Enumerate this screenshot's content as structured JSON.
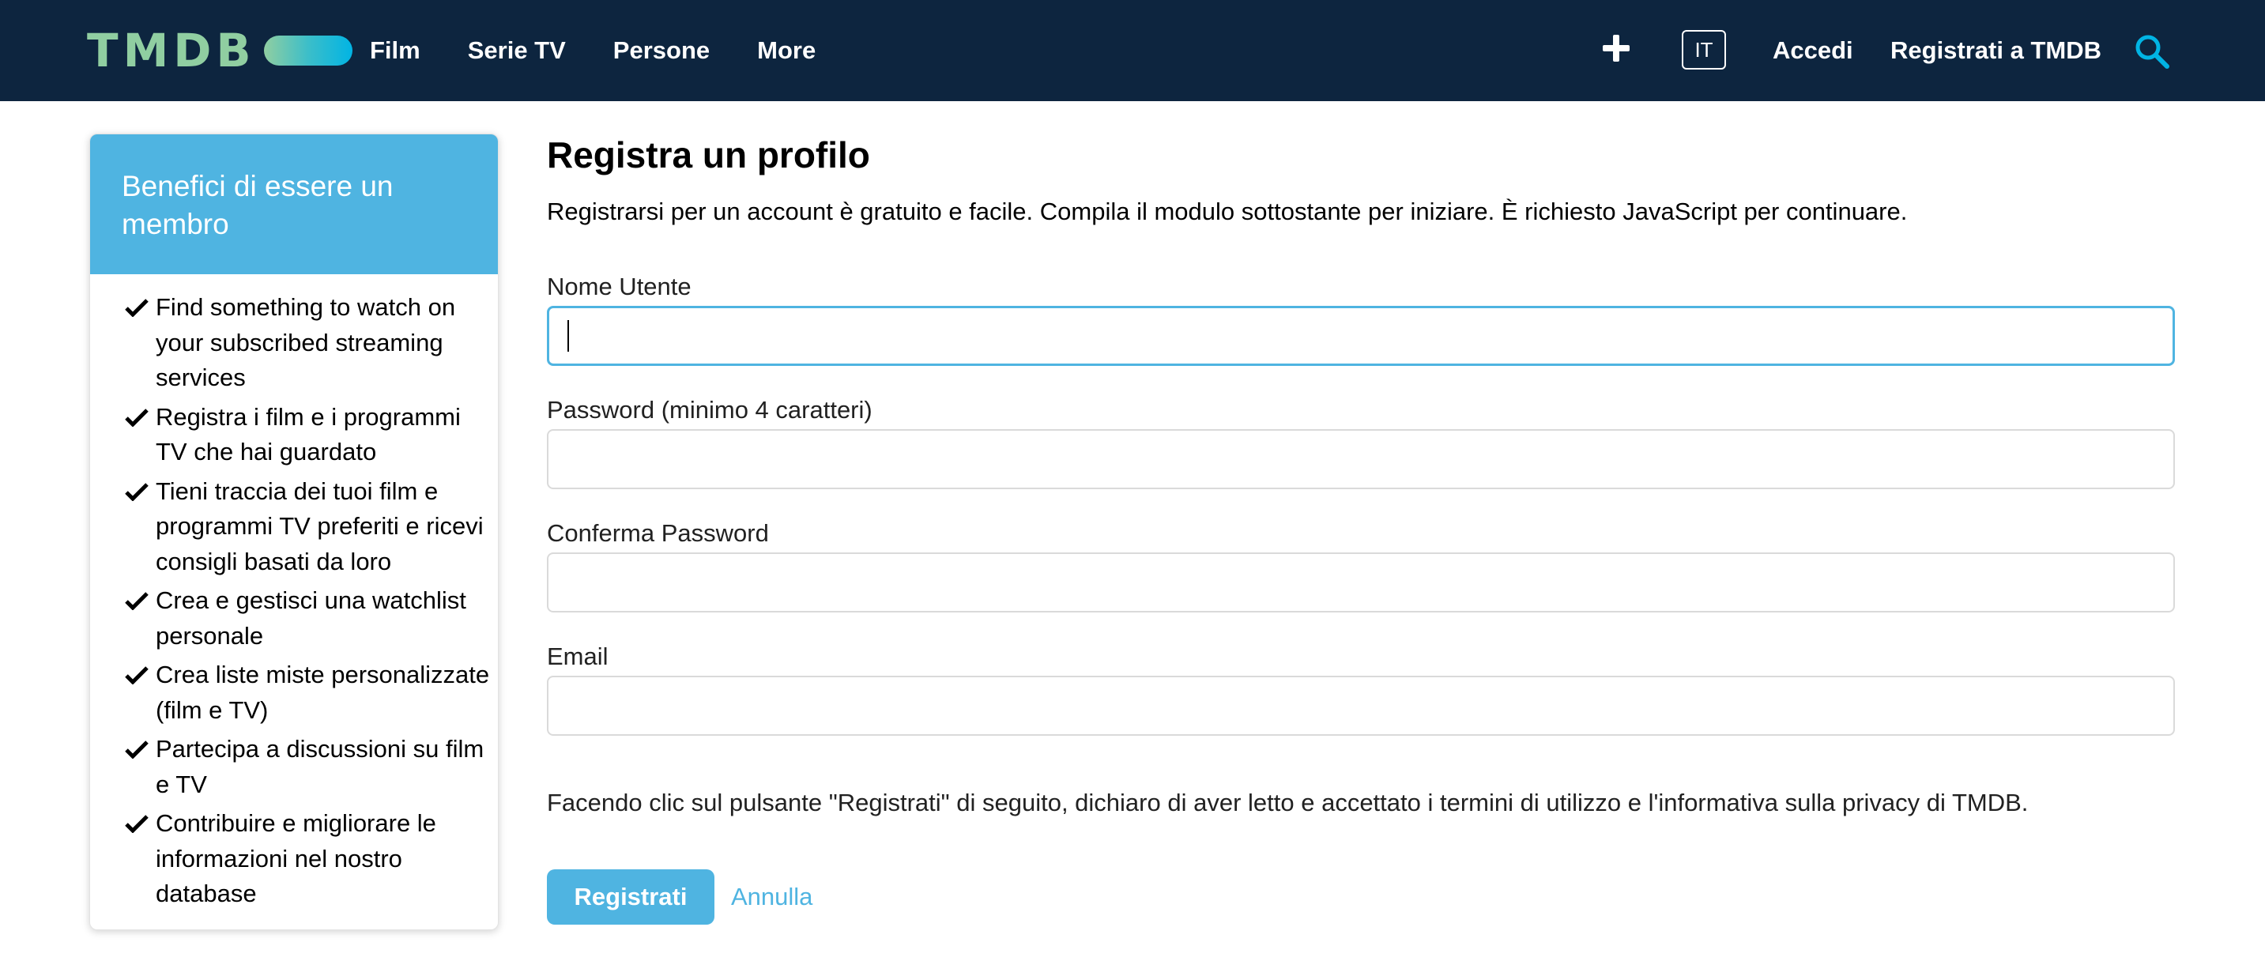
{
  "header": {
    "logo_text": "TMDB",
    "nav": [
      "Film",
      "Serie TV",
      "Persone",
      "More"
    ],
    "lang": "IT",
    "login": "Accedi",
    "register": "Registrati a TMDB"
  },
  "sidebar": {
    "title": "Benefici di essere un membro",
    "items": [
      "Find something to watch on your subscribed streaming services",
      "Registra i film e i programmi TV che hai guardato",
      "Tieni traccia dei tuoi film e programmi TV preferiti e ricevi consigli basati da loro",
      "Crea e gestisci una watchlist personale",
      "Crea liste miste personalizzate (film e TV)",
      "Partecipa a discussioni su film e TV",
      "Contribuire e migliorare le informazioni nel nostro database"
    ]
  },
  "form": {
    "title": "Registra un profilo",
    "intro": "Registrarsi per un account è gratuito e facile. Compila il modulo sottostante per iniziare. È richiesto JavaScript per continuare.",
    "username_label": "Nome Utente",
    "username_value": "",
    "password_label": "Password (minimo 4 caratteri)",
    "password_value": "",
    "confirm_label": "Conferma Password",
    "confirm_value": "",
    "email_label": "Email",
    "email_value": "",
    "terms": "Facendo clic sul pulsante \"Registrati\" di seguito, dichiaro di aver letto e accettato i termini di utilizzo e l'informativa sulla privacy di TMDB.",
    "submit_label": "Registrati",
    "cancel_label": "Annulla"
  },
  "colors": {
    "header_bg": "#0d253f",
    "accent": "#4fb4e1",
    "logo_green": "#90cea1"
  }
}
